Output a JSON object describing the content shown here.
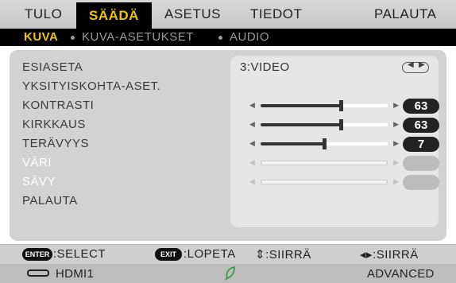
{
  "tabs": [
    "TULO",
    "SÄÄDÄ",
    "ASETUS",
    "TIEDOT",
    "PALAUTA"
  ],
  "active_tab": "SÄÄDÄ",
  "subtabs": [
    "KUVA",
    "KUVA-ASETUKSET",
    "AUDIO"
  ],
  "active_subtab": "KUVA",
  "menu": {
    "preset": {
      "label": "ESIASETA",
      "value": "3:VIDEO"
    },
    "detail": {
      "label": "YKSITYISKOHTA-ASET."
    },
    "contrast": {
      "label": "KONTRASTI",
      "value": "63",
      "level": 63
    },
    "brightness": {
      "label": "KIRKKAUS",
      "value": "63",
      "level": 63
    },
    "sharpness": {
      "label": "TERÄVYYS",
      "value": "7",
      "level": 7
    },
    "color": {
      "label": "VÄRI",
      "enabled": false
    },
    "hue": {
      "label": "SÄVY",
      "enabled": false
    },
    "reset": {
      "label": "PALAUTA"
    }
  },
  "help": {
    "enter_key": "ENTER",
    "enter_text": ":SELECT",
    "exit_key": "EXIT",
    "exit_text": ":LOPETA",
    "move_ud": "⇕:SIIRRÄ",
    "move_lr": "◂▸:SIIRRÄ"
  },
  "status": {
    "input_icon": "hdmi-connector-icon",
    "input": "HDMI1",
    "eco_icon": "eco-leaf-icon",
    "mode": "ADVANCED"
  },
  "colors": {
    "accent": "#f2c300",
    "eco": "#2e9a3a"
  }
}
